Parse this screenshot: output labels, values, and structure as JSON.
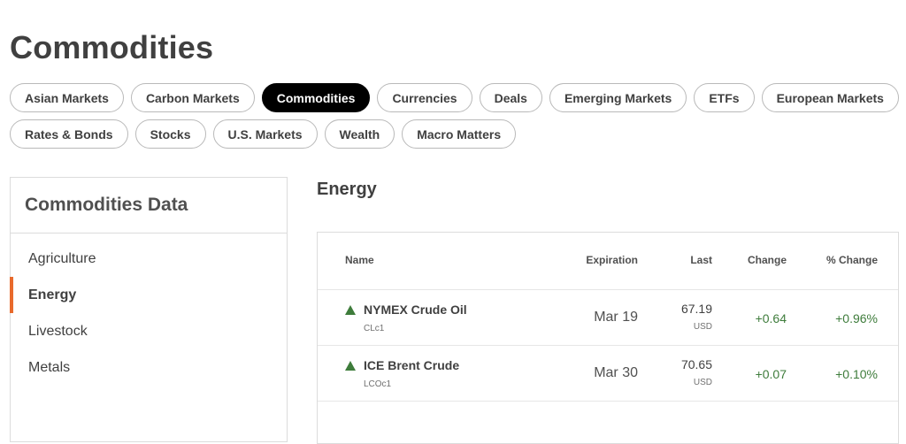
{
  "page": {
    "title": "Commodities"
  },
  "chips": {
    "row1": [
      "Asian Markets",
      "Carbon Markets",
      "Commodities",
      "Currencies",
      "Deals",
      "Emerging Markets",
      "ETFs",
      "European Markets"
    ],
    "row2": [
      "Rates & Bonds",
      "Stocks",
      "U.S. Markets",
      "Wealth",
      "Macro Matters"
    ],
    "active": "Commodities"
  },
  "sidebar": {
    "title": "Commodities Data",
    "items": [
      "Agriculture",
      "Energy",
      "Livestock",
      "Metals"
    ],
    "active": "Energy"
  },
  "section": {
    "title": "Energy"
  },
  "table": {
    "headers": {
      "name": "Name",
      "expiration": "Expiration",
      "last": "Last",
      "change": "Change",
      "pct_change": "% Change"
    },
    "rows": [
      {
        "name": "NYMEX Crude Oil",
        "ric": "CLc1",
        "expiration": "Mar 19",
        "last": "67.19",
        "currency": "USD",
        "change": "+0.64",
        "pct_change": "+0.96%",
        "direction": "up"
      },
      {
        "name": "ICE Brent Crude",
        "ric": "LCOc1",
        "expiration": "Mar 30",
        "last": "70.65",
        "currency": "USD",
        "change": "+0.07",
        "pct_change": "+0.10%",
        "direction": "up"
      }
    ]
  },
  "colors": {
    "accent": "#e86a2c",
    "positive": "#3e7c3b",
    "active_chip": "#000000"
  }
}
